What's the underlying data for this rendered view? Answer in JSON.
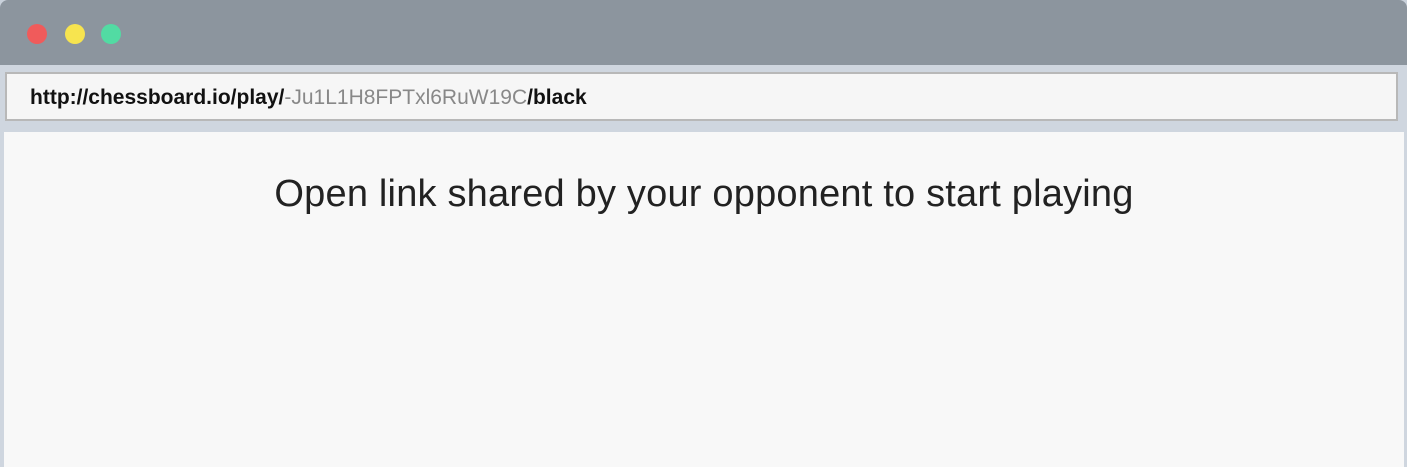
{
  "window": {
    "controls": {
      "close_color": "#f05b5b",
      "minimize_color": "#f7e44f",
      "zoom_color": "#52dba3"
    }
  },
  "address_bar": {
    "url_prefix": "http://chessboard.io/play/",
    "url_game_id": "-Ju1L1H8FPTxl6RuW19C",
    "url_suffix": "/black"
  },
  "main": {
    "message": "Open link shared by your opponent to start playing"
  }
}
